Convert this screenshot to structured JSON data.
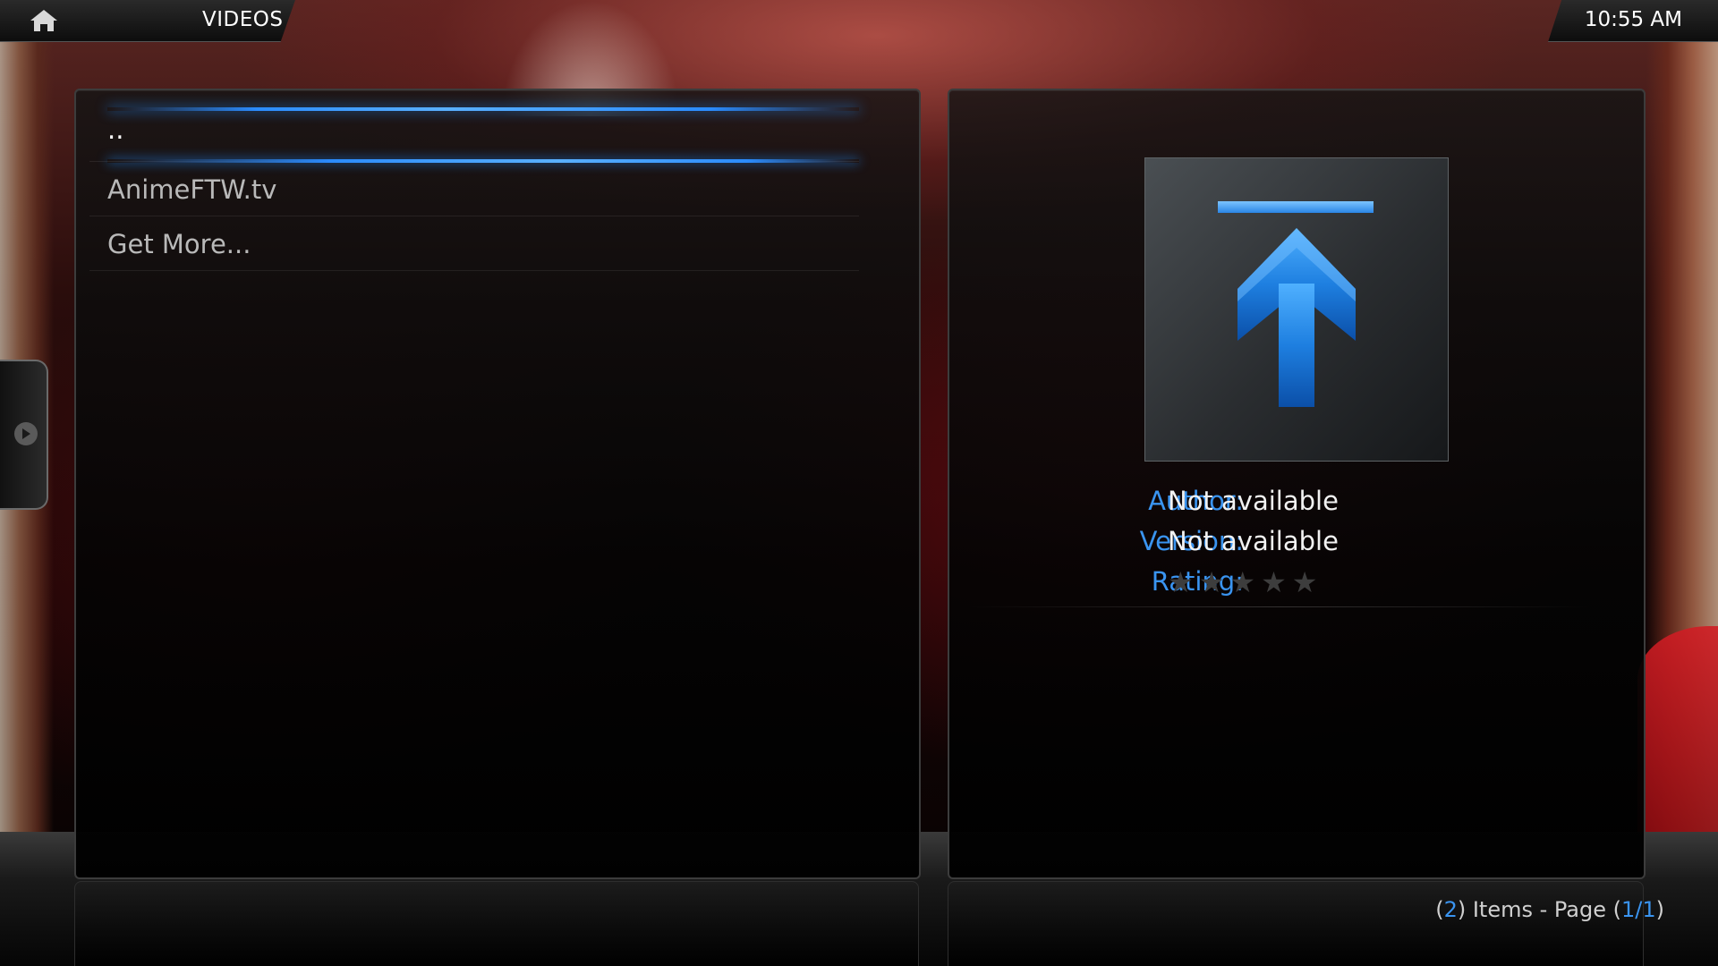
{
  "header": {
    "section_title": "VIDEOS",
    "clock": "10:55 AM"
  },
  "list": {
    "items": [
      {
        "label": ".."
      },
      {
        "label": "AnimeFTW.tv"
      },
      {
        "label": "Get More..."
      }
    ]
  },
  "details": {
    "author_label": "Author:",
    "author_value": "Not available",
    "version_label": "Version:",
    "version_value": "Not available",
    "rating_label": "Rating:",
    "rating_stars": 0,
    "rating_max": 5
  },
  "footer": {
    "item_count": "2",
    "items_text": "Items - Page",
    "page": "1/1"
  },
  "colors": {
    "accent_blue": "#3a94f0",
    "focus_glow": "#2b8cff",
    "text_primary": "#ffffff",
    "text_secondary": "#b9b9b9"
  },
  "icons": {
    "home": "home-icon",
    "thumbnail": "parent-folder-up-arrow-icon",
    "side_tab": "chevron-right-icon",
    "rating": "star-icon"
  }
}
